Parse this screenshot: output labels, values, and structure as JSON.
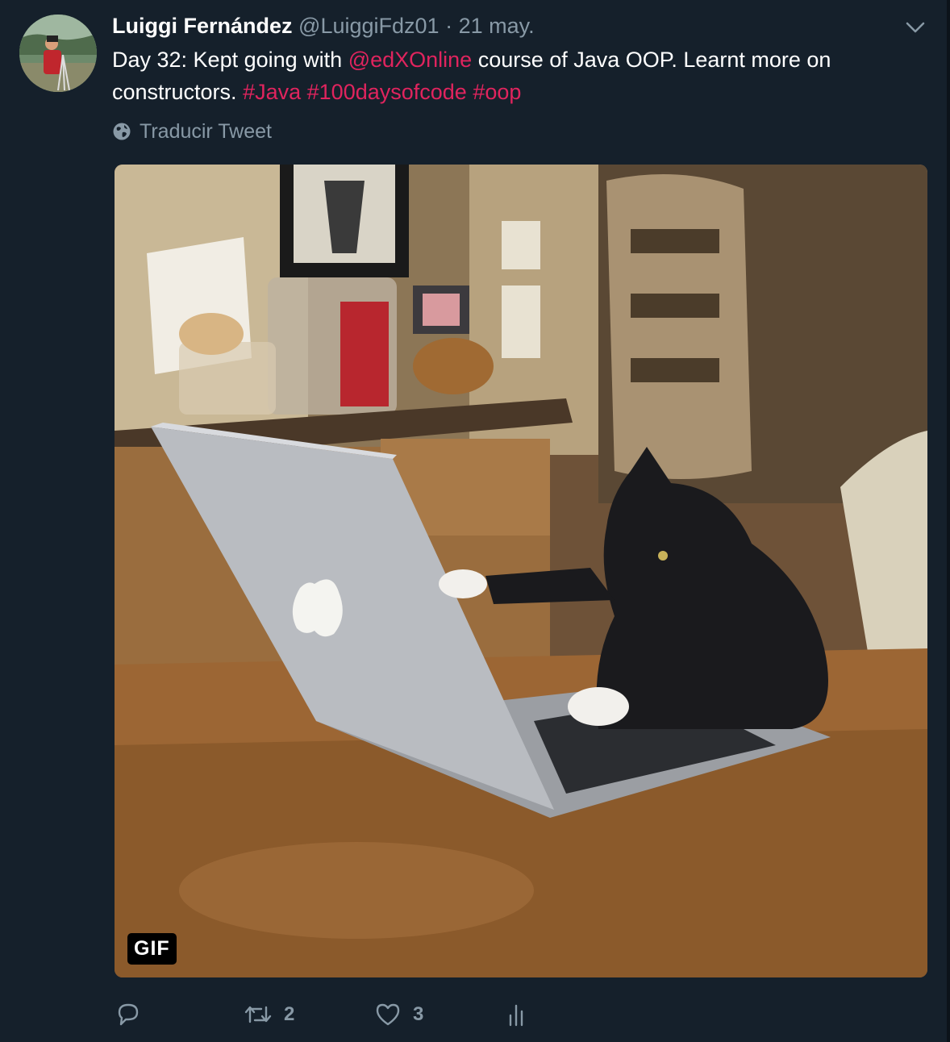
{
  "tweet": {
    "author_name": "Luiggi Fernández",
    "author_handle": "@LuiggiFdz01",
    "separator": "·",
    "date": "21 may.",
    "text_parts": {
      "p1": "Day 32: Kept going with ",
      "mention": "@edXOnline",
      "p2": " course of Java OOP. Learnt more on constructors. ",
      "tag1": "#Java",
      "tag2": "#100daysofcode",
      "tag3": "#oop"
    },
    "translate_label": "Traducir Tweet",
    "media_badge": "GIF",
    "stats": {
      "replies": "",
      "retweets": "2",
      "likes": "3"
    }
  },
  "colors": {
    "background": "#15202b",
    "secondary_text": "#8899a6",
    "link": "#e0245e"
  },
  "icons": [
    "chevron-down-icon",
    "globe-icon",
    "reply-icon",
    "retweet-icon",
    "heart-icon",
    "analytics-icon"
  ]
}
